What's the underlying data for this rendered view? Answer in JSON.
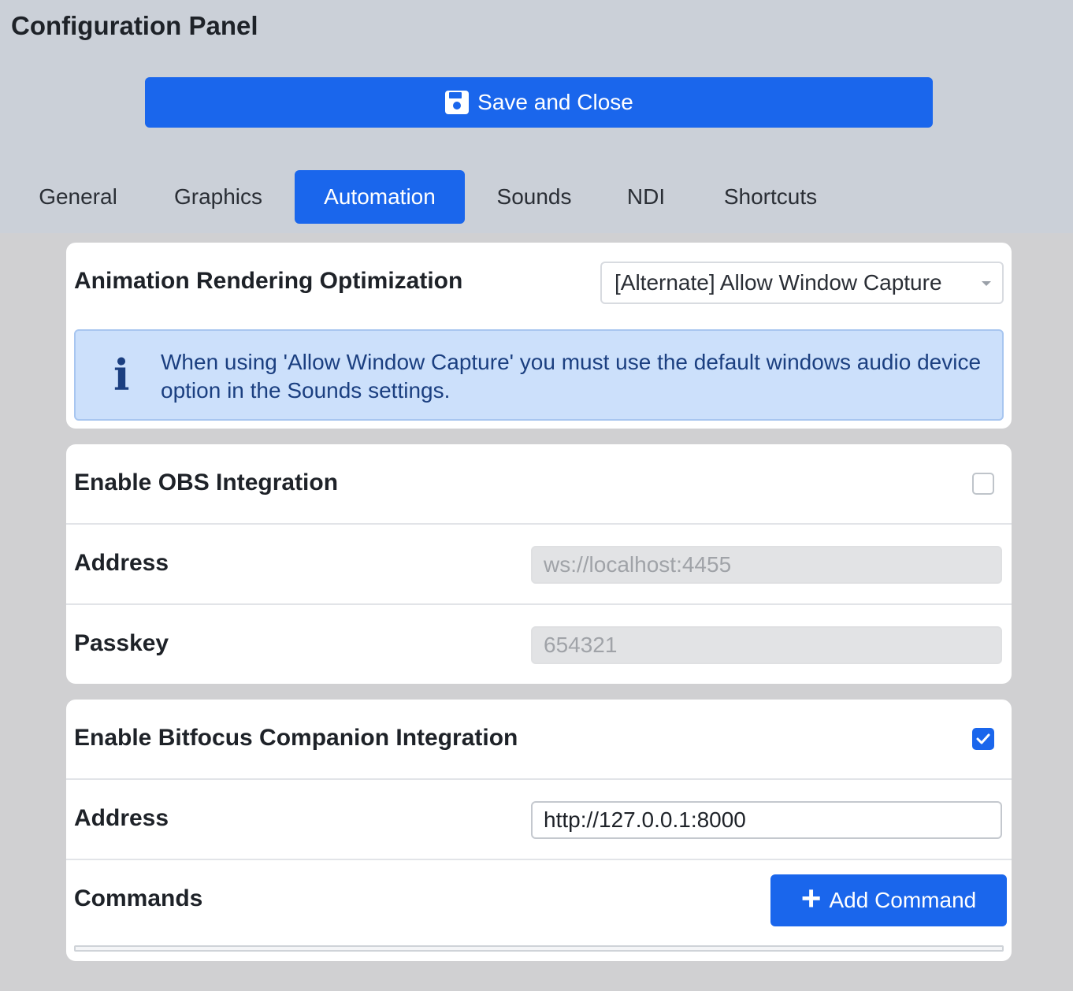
{
  "page": {
    "title": "Configuration Panel"
  },
  "toolbar": {
    "save_label": "Save and Close",
    "save_icon": "floppy-disk-icon"
  },
  "tabs": [
    {
      "label": "General",
      "active": false
    },
    {
      "label": "Graphics",
      "active": false
    },
    {
      "label": "Automation",
      "active": true
    },
    {
      "label": "Sounds",
      "active": false
    },
    {
      "label": "NDI",
      "active": false
    },
    {
      "label": "Shortcuts",
      "active": false
    }
  ],
  "rendering": {
    "label": "Animation Rendering Optimization",
    "selected": "[Alternate] Allow Window Capture",
    "info_icon": "info-icon",
    "info_text": "When using 'Allow Window Capture' you must use the default windows audio device option in the Sounds settings."
  },
  "obs": {
    "label": "Enable OBS Integration",
    "enabled": false,
    "address_label": "Address",
    "address_value": "ws://localhost:4455",
    "passkey_label": "Passkey",
    "passkey_value": "654321"
  },
  "companion": {
    "label": "Enable Bitfocus Companion Integration",
    "enabled": true,
    "address_label": "Address",
    "address_value": "http://127.0.0.1:8000",
    "commands_label": "Commands",
    "add_label": "Add Command"
  },
  "colors": {
    "accent": "#1a66ec",
    "background": "#cbd0d8",
    "info_bg": "#cce0fb",
    "info_text": "#1b3f80"
  }
}
